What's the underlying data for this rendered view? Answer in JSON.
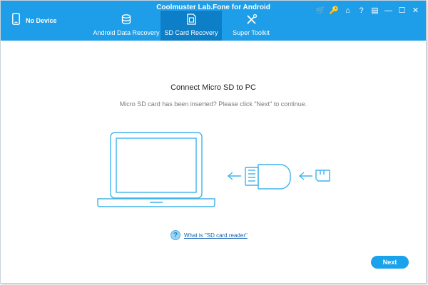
{
  "app": {
    "title": "Coolmuster Lab.Fone for Android"
  },
  "device": {
    "label": "No Device",
    "icon": "phone-icon"
  },
  "tabs": [
    {
      "label": "Android Data Recovery",
      "icon": "database-icon"
    },
    {
      "label": "SD Card Recovery",
      "icon": "sd-card-icon",
      "active": true
    },
    {
      "label": "Super Toolkit",
      "icon": "tools-icon"
    }
  ],
  "window_controls": [
    {
      "name": "cart-icon",
      "glyph": "🛒"
    },
    {
      "name": "key-icon",
      "glyph": "🔑"
    },
    {
      "name": "home-icon",
      "glyph": "⌂"
    },
    {
      "name": "help-icon",
      "glyph": "?"
    },
    {
      "name": "feedback-icon",
      "glyph": "▤"
    },
    {
      "name": "minimize-icon",
      "glyph": "—"
    },
    {
      "name": "maximize-icon",
      "glyph": "☐"
    },
    {
      "name": "close-icon",
      "glyph": "✕"
    }
  ],
  "main": {
    "heading": "Connect Micro SD to PC",
    "subtext": "Micro SD card has been inserted? Please click \"Next\" to continue.",
    "help_link": "What is \"SD card reader\"",
    "help_glyph": "?",
    "next_label": "Next"
  },
  "colors": {
    "titlebar": "#1e9ee8",
    "active_tab": "#0d7fc8",
    "illustration": "#3fb3ec",
    "button": "#1aa3ea"
  }
}
